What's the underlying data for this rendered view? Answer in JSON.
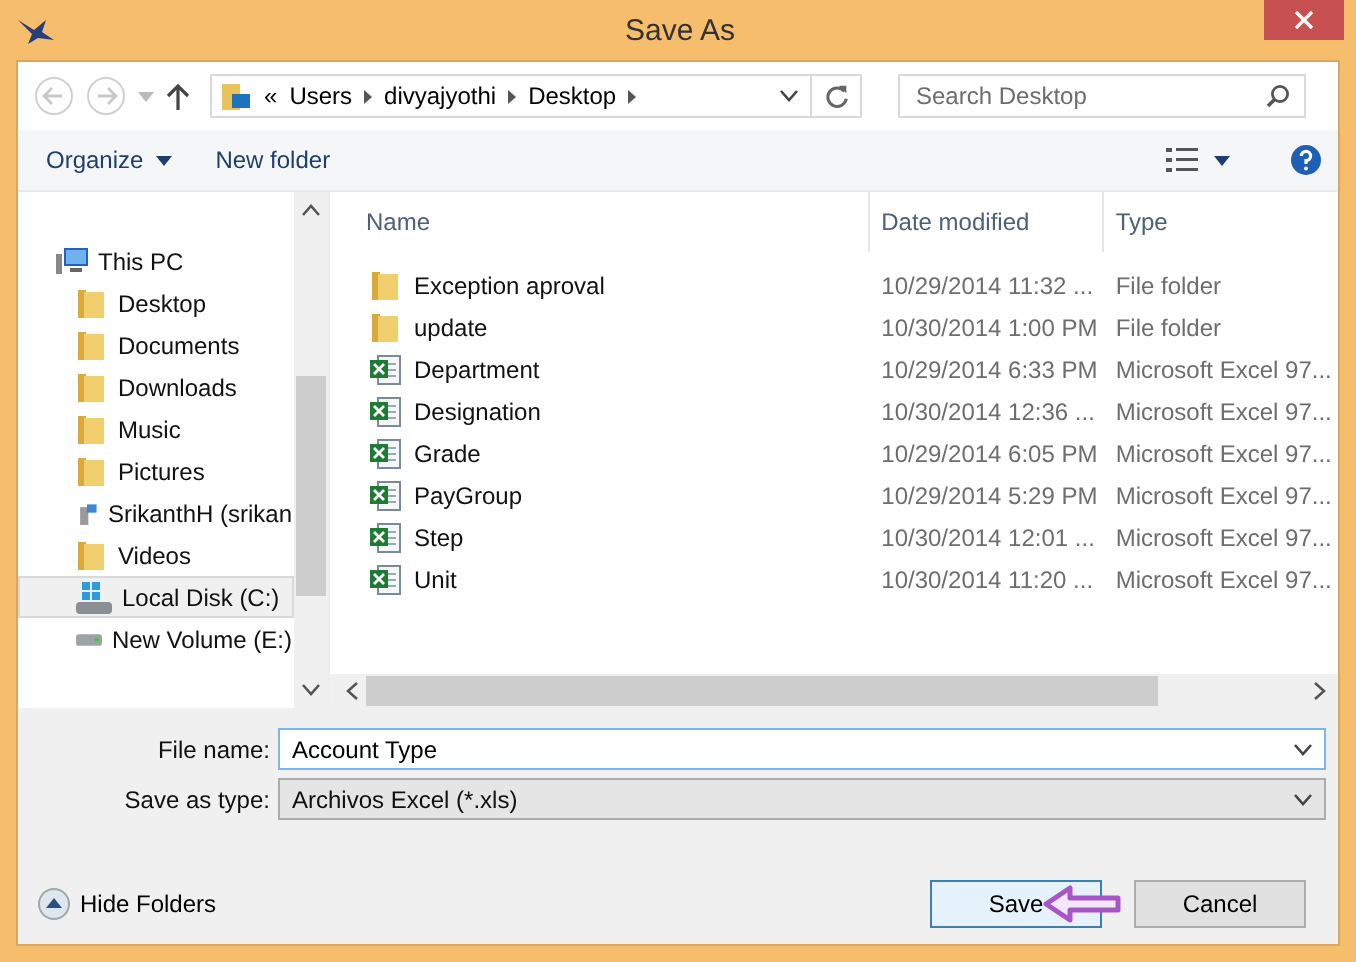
{
  "window": {
    "title": "Save As"
  },
  "nav": {
    "back_disabled": true,
    "forward_disabled": true,
    "path": [
      "«",
      "Users",
      "divyajyothi",
      "Desktop"
    ],
    "search": {
      "placeholder": "Search Desktop"
    }
  },
  "toolbar": {
    "organize": "Organize",
    "new_folder": "New folder"
  },
  "sidebar": {
    "items": [
      {
        "label": "This PC",
        "kind": "pc",
        "selected": false,
        "children": [
          {
            "label": "Desktop",
            "kind": "folder",
            "selected": false
          },
          {
            "label": "Documents",
            "kind": "folder",
            "selected": false
          },
          {
            "label": "Downloads",
            "kind": "folder",
            "selected": false
          },
          {
            "label": "Music",
            "kind": "folder",
            "selected": false
          },
          {
            "label": "Pictures",
            "kind": "folder",
            "selected": false
          },
          {
            "label": "SrikanthH (srikan",
            "kind": "netdrive",
            "selected": false
          },
          {
            "label": "Videos",
            "kind": "folder",
            "selected": false
          },
          {
            "label": "Local Disk (C:)",
            "kind": "sysdrive",
            "selected": true
          },
          {
            "label": "New Volume (E:)",
            "kind": "drive",
            "selected": false
          }
        ]
      }
    ]
  },
  "table": {
    "columns": [
      "Name",
      "Date modified",
      "Type"
    ],
    "rows": [
      {
        "kind": "folder",
        "name": "Exception aproval",
        "date": "10/29/2014 11:32 ...",
        "type": "File folder"
      },
      {
        "kind": "folder",
        "name": "update",
        "date": "10/30/2014 1:00 PM",
        "type": "File folder"
      },
      {
        "kind": "excel",
        "name": "Department",
        "date": "10/29/2014 6:33 PM",
        "type": "Microsoft Excel 97..."
      },
      {
        "kind": "excel",
        "name": "Designation",
        "date": "10/30/2014 12:36 ...",
        "type": "Microsoft Excel 97..."
      },
      {
        "kind": "excel",
        "name": "Grade",
        "date": "10/29/2014 6:05 PM",
        "type": "Microsoft Excel 97..."
      },
      {
        "kind": "excel",
        "name": "PayGroup",
        "date": "10/29/2014 5:29 PM",
        "type": "Microsoft Excel 97..."
      },
      {
        "kind": "excel",
        "name": "Step",
        "date": "10/30/2014 12:01 ...",
        "type": "Microsoft Excel 97..."
      },
      {
        "kind": "excel",
        "name": "Unit",
        "date": "10/30/2014 11:20 ...",
        "type": "Microsoft Excel 97..."
      }
    ]
  },
  "form": {
    "file_name_label": "File name:",
    "file_name": "Account Type",
    "type_label": "Save as type:",
    "type_value": "Archivos Excel (*.xls)"
  },
  "hide_folders": "Hide Folders",
  "buttons": [
    {
      "label": "Save",
      "default": true
    },
    {
      "label": "Cancel",
      "default": false
    }
  ]
}
